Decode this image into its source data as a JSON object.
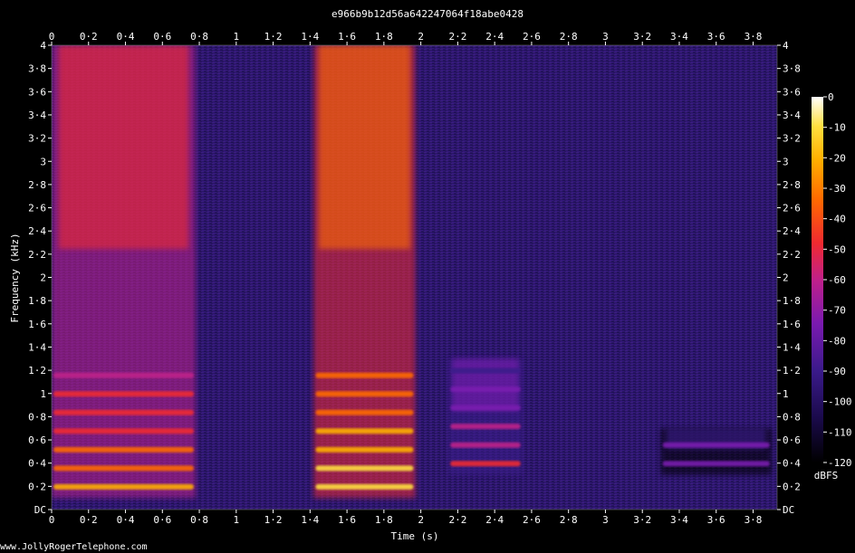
{
  "chart_data": {
    "type": "heatmap",
    "title": "e966b9b12d56a642247064f18abe0428",
    "xlabel": "Time (s)",
    "ylabel": "Frequency (kHz)",
    "xlim": [
      0,
      3.93
    ],
    "ylim": [
      0,
      4
    ],
    "x_ticks": [
      "0",
      "0·2",
      "0·4",
      "0·6",
      "0·8",
      "1",
      "1·2",
      "1·4",
      "1·6",
      "1·8",
      "2",
      "2·2",
      "2·4",
      "2·6",
      "2·8",
      "3",
      "3·2",
      "3·4",
      "3·6",
      "3·8"
    ],
    "y_ticks": [
      "DC",
      "0·2",
      "0·4",
      "0·6",
      "0·8",
      "1",
      "1·2",
      "1·4",
      "1·6",
      "1·8",
      "2",
      "2·2",
      "2·4",
      "2·6",
      "2·8",
      "3",
      "3·2",
      "3·4",
      "3·6",
      "3·8",
      "4"
    ],
    "colorbar": {
      "label": "dBFS",
      "range": [
        -120,
        0
      ],
      "ticks": [
        "0",
        "-10",
        "-20",
        "-30",
        "-40",
        "-50",
        "-60",
        "-70",
        "-80",
        "-90",
        "-100",
        "-110",
        "-120"
      ],
      "colors": [
        "#000000",
        "#1a0a4a",
        "#3a1a8a",
        "#7a1ab0",
        "#c0208a",
        "#f02a30",
        "#ff6a00",
        "#ffb000",
        "#ffe040",
        "#ffffff"
      ]
    },
    "energy_regions": [
      {
        "t_start": 0.0,
        "t_end": 0.78,
        "f_low": 0.1,
        "f_high": 4.0,
        "peak_dbfs": -30
      },
      {
        "t_start": 1.42,
        "t_end": 1.97,
        "f_low": 0.1,
        "f_high": 4.0,
        "peak_dbfs": -10
      },
      {
        "t_start": 2.15,
        "t_end": 2.55,
        "f_low": 0.3,
        "f_high": 1.3,
        "peak_dbfs": -60
      },
      {
        "t_start": 3.3,
        "t_end": 3.9,
        "f_low": 0.3,
        "f_high": 0.7,
        "peak_dbfs": -75
      }
    ],
    "background_dbfs": -100
  },
  "watermark": "www.JollyRogerTelephone.com"
}
